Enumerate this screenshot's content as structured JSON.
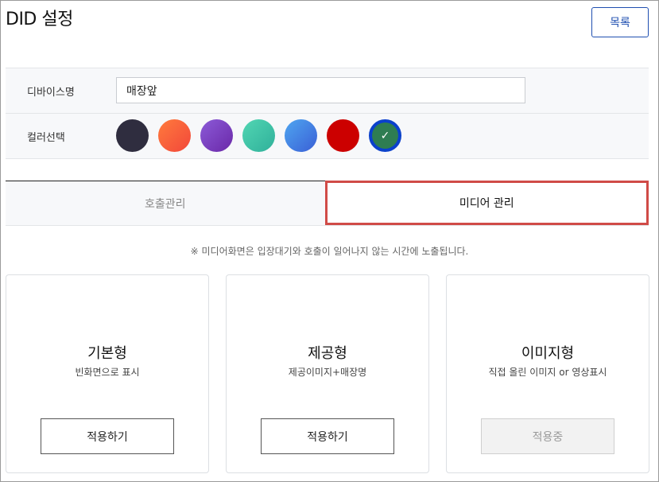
{
  "header": {
    "title": "DID 설정",
    "list_label": "목록"
  },
  "form": {
    "device_label": "디바이스명",
    "device_value": "매장앞",
    "color_label": "컬러선택",
    "colors": [
      {
        "name": "dark-navy",
        "css": "#2f2d3f"
      },
      {
        "name": "orange",
        "css": "linear-gradient(135deg,#ff7b3d,#f2473a)"
      },
      {
        "name": "purple",
        "css": "linear-gradient(135deg,#8c5bd8,#6a28a8)"
      },
      {
        "name": "teal",
        "css": "linear-gradient(135deg,#52d6b3,#2fb09a)"
      },
      {
        "name": "blue",
        "css": "linear-gradient(135deg,#4fa6f0,#3a5fd6)"
      },
      {
        "name": "red",
        "css": "#cc0000"
      },
      {
        "name": "green",
        "css": "#2e7d52",
        "selected": true
      }
    ]
  },
  "tabs": {
    "call": "호출관리",
    "media": "미디어 관리"
  },
  "notice": "※ 미디어화면은 입장대기와 호출이 일어나지 않는 시간에 노출됩니다.",
  "cards": [
    {
      "title": "기본형",
      "desc": "빈화면으로 표시",
      "button": "적용하기"
    },
    {
      "title": "제공형",
      "desc": "제공이미지+매장명",
      "button": "적용하기"
    },
    {
      "title": "이미지형",
      "desc": "직접 올린 이미지 or 영상표시",
      "button": "적용중"
    }
  ]
}
